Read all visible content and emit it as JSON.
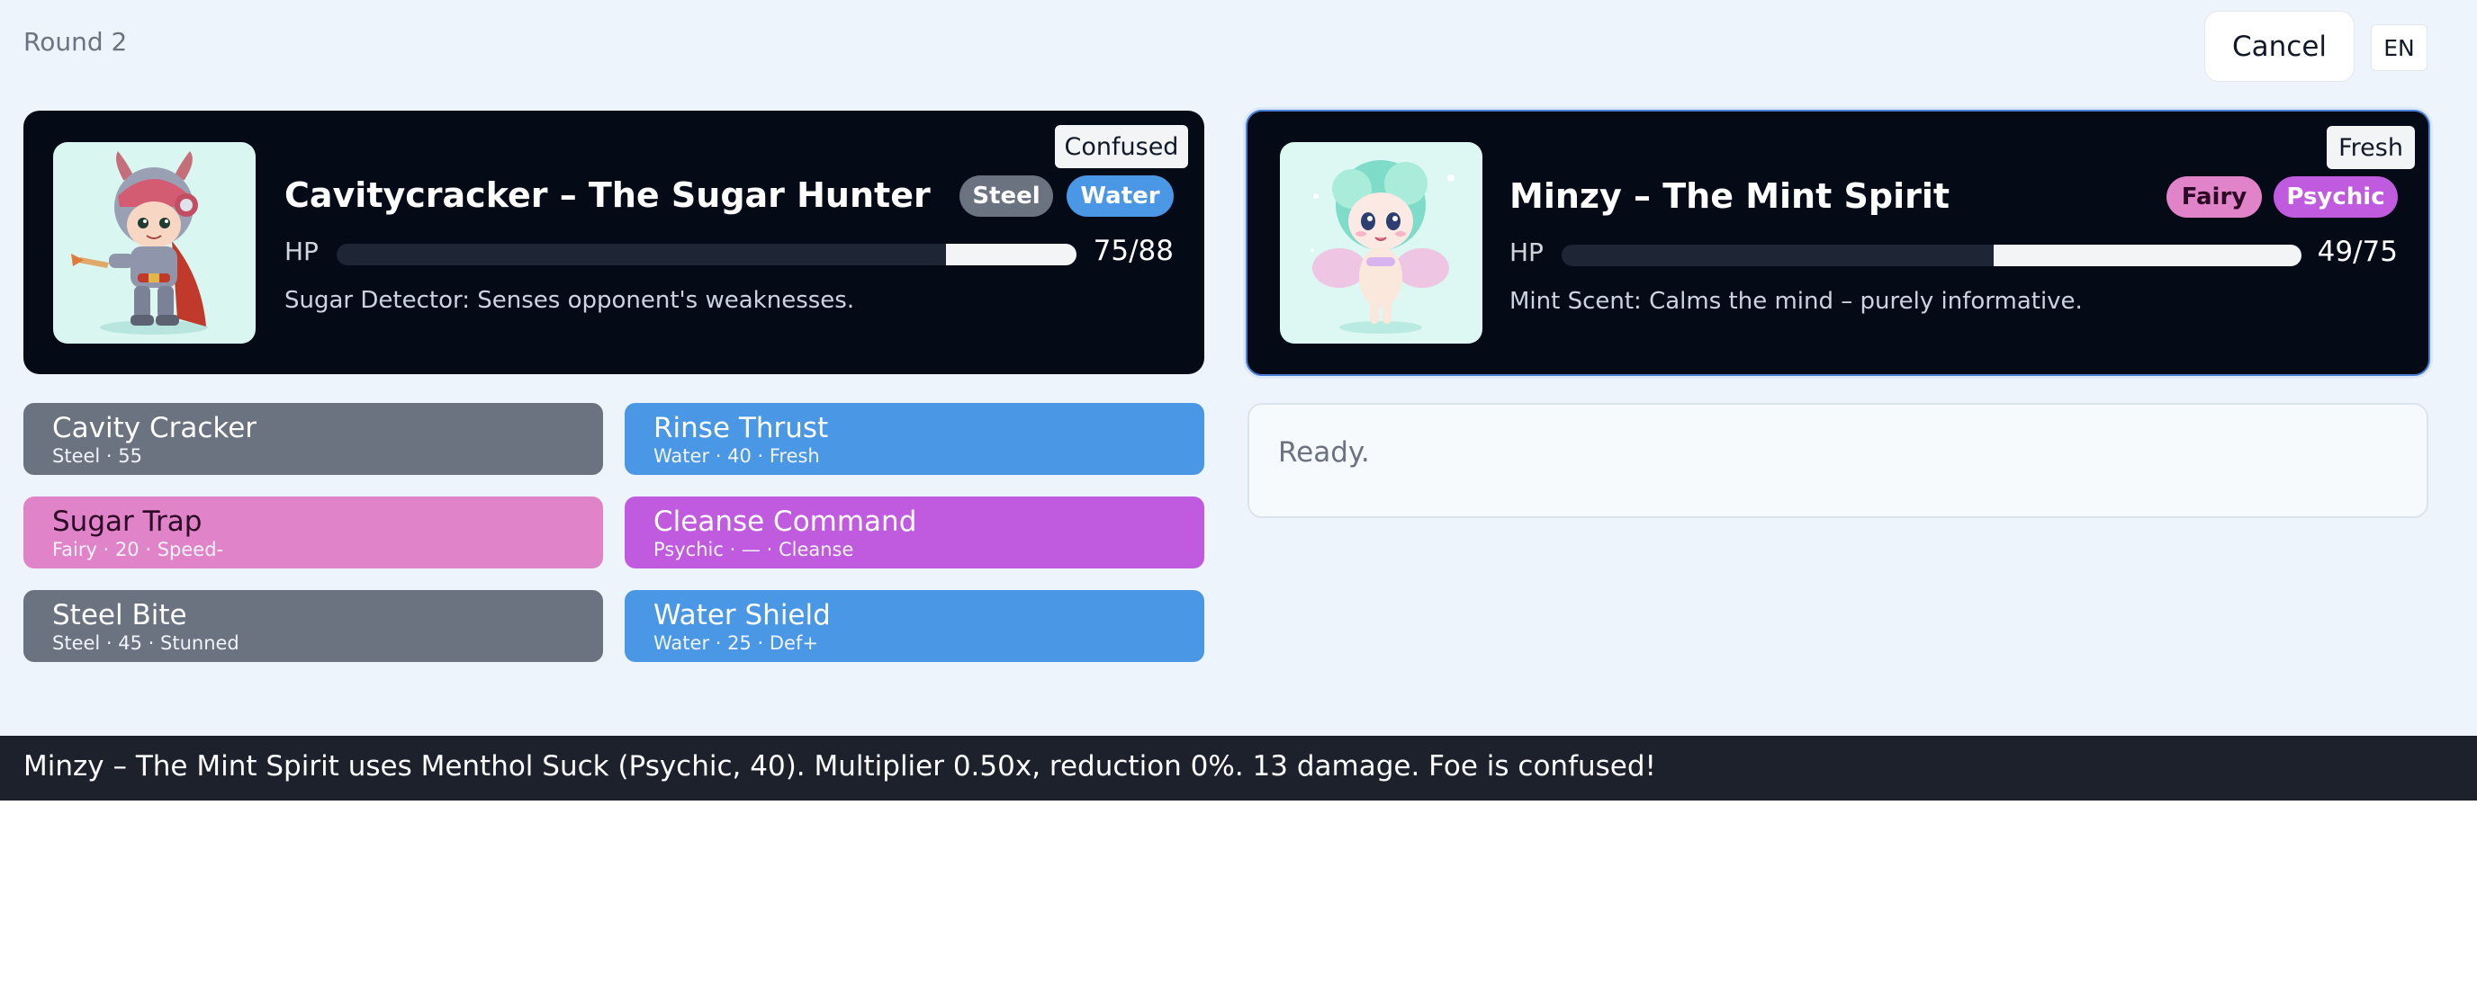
{
  "header": {
    "round_label": "Round 2",
    "cancel_label": "Cancel",
    "language_label": "EN"
  },
  "player": {
    "name": "Cavitycracker – The Sugar Hunter",
    "status": "Confused",
    "types": [
      {
        "label": "Steel",
        "color": "#6b7280"
      },
      {
        "label": "Water",
        "color": "#4a97e6"
      }
    ],
    "hp_label": "HP",
    "hp_text": "75/88",
    "hp_current": 75,
    "hp_max": 88,
    "ability": "Sugar Detector: Senses opponent's weaknesses."
  },
  "opponent": {
    "name": "Minzy – The Mint Spirit",
    "status": "Fresh",
    "types": [
      {
        "label": "Fairy",
        "color": "#e083c8"
      },
      {
        "label": "Psychic",
        "color": "#c05ade"
      }
    ],
    "hp_label": "HP",
    "hp_text": "49/75",
    "hp_current": 49,
    "hp_max": 75,
    "ability": "Mint Scent: Calms the mind – purely informative."
  },
  "moves": [
    {
      "name": "Cavity Cracker",
      "meta": "Steel · 55",
      "type": "steel"
    },
    {
      "name": "Rinse Thrust",
      "meta": "Water · 40 · Fresh",
      "type": "water"
    },
    {
      "name": "Sugar Trap",
      "meta": "Fairy · 20 · Speed-",
      "type": "fairy"
    },
    {
      "name": "Cleanse Command",
      "meta": "Psychic · — · Cleanse",
      "type": "psychic"
    },
    {
      "name": "Steel Bite",
      "meta": "Steel · 45 · Stunned",
      "type": "steel"
    },
    {
      "name": "Water Shield",
      "meta": "Water · 25 · Def+",
      "type": "water"
    }
  ],
  "status_panel": {
    "text": "Ready."
  },
  "battle_log": {
    "text": "Minzy – The Mint Spirit uses Menthol Suck (Psychic, 40). Multiplier 0.50x, reduction 0%. 13 damage. Foe is confused!"
  }
}
